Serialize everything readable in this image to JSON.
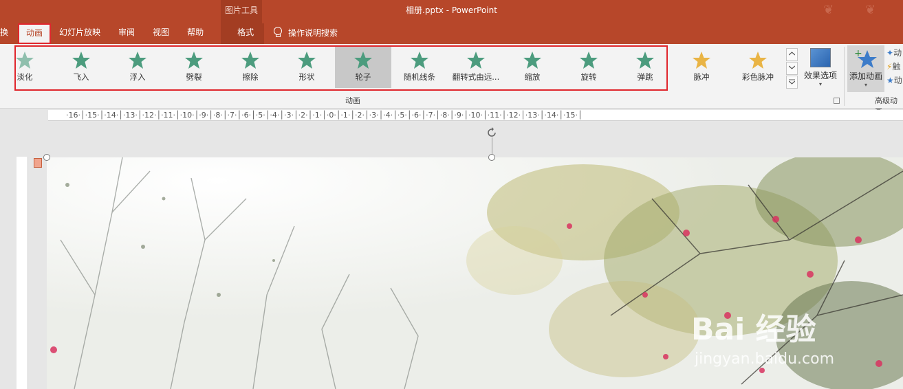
{
  "window": {
    "title": "相册.pptx  -  PowerPoint"
  },
  "context_tab_group": {
    "label": "图片工具"
  },
  "tabs": [
    {
      "label": "换",
      "left": 0,
      "width": 22
    },
    {
      "label": "动画",
      "active": true
    },
    {
      "label": "幻灯片放映"
    },
    {
      "label": "审阅"
    },
    {
      "label": "视图"
    },
    {
      "label": "帮助"
    },
    {
      "label": "格式"
    }
  ],
  "tell_me": {
    "label": "操作说明搜索"
  },
  "animations": [
    {
      "label": "淡化",
      "icon": "fade-star-icon"
    },
    {
      "label": "飞入",
      "icon": "fly-in-star-icon"
    },
    {
      "label": "浮入",
      "icon": "float-in-star-icon"
    },
    {
      "label": "劈裂",
      "icon": "split-star-icon"
    },
    {
      "label": "擦除",
      "icon": "wipe-star-icon"
    },
    {
      "label": "形状",
      "icon": "shape-star-icon"
    },
    {
      "label": "轮子",
      "icon": "wheel-star-icon",
      "selected": true
    },
    {
      "label": "随机线条",
      "icon": "random-bars-star-icon"
    },
    {
      "label": "翻转式由远...",
      "icon": "grow-turn-star-icon"
    },
    {
      "label": "缩放",
      "icon": "zoom-star-icon"
    },
    {
      "label": "旋转",
      "icon": "swivel-star-icon"
    },
    {
      "label": "弹跳",
      "icon": "bounce-star-icon"
    },
    {
      "label": "脉冲",
      "icon": "pulse-star-icon"
    },
    {
      "label": "彩色脉冲",
      "icon": "color-pulse-star-icon"
    }
  ],
  "effect_options": {
    "label": "效果选项"
  },
  "add_animation": {
    "label": "添加动画"
  },
  "groups": {
    "animation": "动画",
    "advanced": "高级动画"
  },
  "advanced_items": [
    "动",
    "触",
    "动"
  ],
  "ruler": {
    "h_text": "·16·│·15·│·14·│·13·│·12·│·11·│·10·│·9·│·8·│·7·│·6·│·5·│·4·│·3·│·2·│·1·│·0·│·1·│·2·│·3·│·4·│·5·│·6·│·7·│·8·│·9·│·10·│·11·│·12·│·13·│·14·│·15·│"
  },
  "watermark": {
    "brand": "Bai 经验",
    "url": "jingyan.baidu.com"
  },
  "colors": {
    "brand": "#b7472a",
    "highlight": "#e0262c",
    "star_green": "#4c9c7e"
  }
}
